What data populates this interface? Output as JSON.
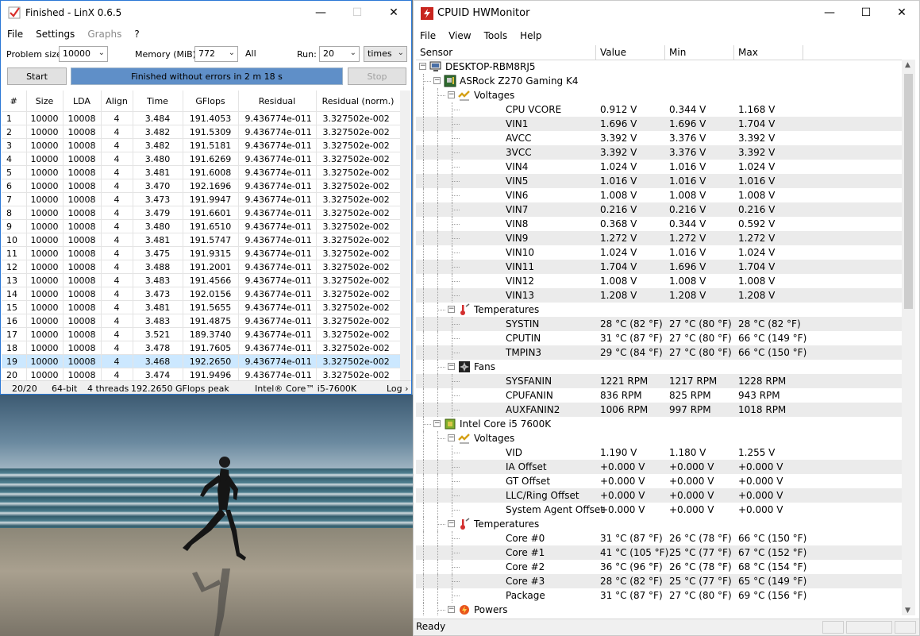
{
  "linx": {
    "title": "Finished - LinX 0.6.5",
    "menu": [
      "File",
      "Settings",
      "Graphs",
      "?"
    ],
    "problem_size_label": "Problem size:",
    "problem_size_value": "10000",
    "memory_label": "Memory (MiB):",
    "memory_value": "772",
    "memory_all": "All",
    "run_label": "Run:",
    "run_value": "20",
    "run_unit": "times",
    "start_label": "Start",
    "stop_label": "Stop",
    "progress_text": "Finished without errors in 2 m 18 s",
    "progress_fraction": 1.0,
    "columns": [
      "#",
      "Size",
      "LDA",
      "Align",
      "Time",
      "GFlops",
      "Residual",
      "Residual (norm.)"
    ],
    "rows": [
      [
        "1",
        "10000",
        "10008",
        "4",
        "3.484",
        "191.4053",
        "9.436774e-011",
        "3.327502e-002"
      ],
      [
        "2",
        "10000",
        "10008",
        "4",
        "3.482",
        "191.5309",
        "9.436774e-011",
        "3.327502e-002"
      ],
      [
        "3",
        "10000",
        "10008",
        "4",
        "3.482",
        "191.5181",
        "9.436774e-011",
        "3.327502e-002"
      ],
      [
        "4",
        "10000",
        "10008",
        "4",
        "3.480",
        "191.6269",
        "9.436774e-011",
        "3.327502e-002"
      ],
      [
        "5",
        "10000",
        "10008",
        "4",
        "3.481",
        "191.6008",
        "9.436774e-011",
        "3.327502e-002"
      ],
      [
        "6",
        "10000",
        "10008",
        "4",
        "3.470",
        "192.1696",
        "9.436774e-011",
        "3.327502e-002"
      ],
      [
        "7",
        "10000",
        "10008",
        "4",
        "3.473",
        "191.9947",
        "9.436774e-011",
        "3.327502e-002"
      ],
      [
        "8",
        "10000",
        "10008",
        "4",
        "3.479",
        "191.6601",
        "9.436774e-011",
        "3.327502e-002"
      ],
      [
        "9",
        "10000",
        "10008",
        "4",
        "3.480",
        "191.6510",
        "9.436774e-011",
        "3.327502e-002"
      ],
      [
        "10",
        "10000",
        "10008",
        "4",
        "3.481",
        "191.5747",
        "9.436774e-011",
        "3.327502e-002"
      ],
      [
        "11",
        "10000",
        "10008",
        "4",
        "3.475",
        "191.9315",
        "9.436774e-011",
        "3.327502e-002"
      ],
      [
        "12",
        "10000",
        "10008",
        "4",
        "3.488",
        "191.2001",
        "9.436774e-011",
        "3.327502e-002"
      ],
      [
        "13",
        "10000",
        "10008",
        "4",
        "3.483",
        "191.4566",
        "9.436774e-011",
        "3.327502e-002"
      ],
      [
        "14",
        "10000",
        "10008",
        "4",
        "3.473",
        "192.0156",
        "9.436774e-011",
        "3.327502e-002"
      ],
      [
        "15",
        "10000",
        "10008",
        "4",
        "3.481",
        "191.5655",
        "9.436774e-011",
        "3.327502e-002"
      ],
      [
        "16",
        "10000",
        "10008",
        "4",
        "3.483",
        "191.4875",
        "9.436774e-011",
        "3.327502e-002"
      ],
      [
        "17",
        "10000",
        "10008",
        "4",
        "3.521",
        "189.3740",
        "9.436774e-011",
        "3.327502e-002"
      ],
      [
        "18",
        "10000",
        "10008",
        "4",
        "3.478",
        "191.7605",
        "9.436774e-011",
        "3.327502e-002"
      ],
      [
        "19",
        "10000",
        "10008",
        "4",
        "3.468",
        "192.2650",
        "9.436774e-011",
        "3.327502e-002"
      ],
      [
        "20",
        "10000",
        "10008",
        "4",
        "3.474",
        "191.9496",
        "9.436774e-011",
        "3.327502e-002"
      ]
    ],
    "selected_row": "19",
    "status": {
      "runs": "20/20",
      "bits": "64-bit",
      "threads": "4 threads",
      "peak": "192.2650 GFlops peak",
      "cpu": "Intel® Core™ i5-7600K",
      "log": "Log ›"
    }
  },
  "hwm": {
    "title": "CPUID HWMonitor",
    "menu": [
      "File",
      "View",
      "Tools",
      "Help"
    ],
    "columns": [
      "Sensor",
      "Value",
      "Min",
      "Max"
    ],
    "status_text": "Ready",
    "rows": [
      {
        "type": "root",
        "name": "DESKTOP-RBM8RJ5",
        "icon": "computer-icon"
      },
      {
        "type": "device",
        "name": "ASRock Z270 Gaming K4",
        "icon": "motherboard-icon"
      },
      {
        "type": "group",
        "name": "Voltages",
        "icon": "voltage-icon"
      },
      {
        "type": "sensor",
        "name": "CPU VCORE",
        "value": "0.912 V",
        "min": "0.344 V",
        "max": "1.168 V"
      },
      {
        "type": "sensor",
        "name": "VIN1",
        "value": "1.696 V",
        "min": "1.696 V",
        "max": "1.704 V"
      },
      {
        "type": "sensor",
        "name": "AVCC",
        "value": "3.392 V",
        "min": "3.376 V",
        "max": "3.392 V"
      },
      {
        "type": "sensor",
        "name": "3VCC",
        "value": "3.392 V",
        "min": "3.376 V",
        "max": "3.392 V"
      },
      {
        "type": "sensor",
        "name": "VIN4",
        "value": "1.024 V",
        "min": "1.016 V",
        "max": "1.024 V"
      },
      {
        "type": "sensor",
        "name": "VIN5",
        "value": "1.016 V",
        "min": "1.016 V",
        "max": "1.016 V"
      },
      {
        "type": "sensor",
        "name": "VIN6",
        "value": "1.008 V",
        "min": "1.008 V",
        "max": "1.008 V"
      },
      {
        "type": "sensor",
        "name": "VIN7",
        "value": "0.216 V",
        "min": "0.216 V",
        "max": "0.216 V"
      },
      {
        "type": "sensor",
        "name": "VIN8",
        "value": "0.368 V",
        "min": "0.344 V",
        "max": "0.592 V"
      },
      {
        "type": "sensor",
        "name": "VIN9",
        "value": "1.272 V",
        "min": "1.272 V",
        "max": "1.272 V"
      },
      {
        "type": "sensor",
        "name": "VIN10",
        "value": "1.024 V",
        "min": "1.016 V",
        "max": "1.024 V"
      },
      {
        "type": "sensor",
        "name": "VIN11",
        "value": "1.704 V",
        "min": "1.696 V",
        "max": "1.704 V"
      },
      {
        "type": "sensor",
        "name": "VIN12",
        "value": "1.008 V",
        "min": "1.008 V",
        "max": "1.008 V"
      },
      {
        "type": "sensor",
        "name": "VIN13",
        "value": "1.208 V",
        "min": "1.208 V",
        "max": "1.208 V"
      },
      {
        "type": "group",
        "name": "Temperatures",
        "icon": "thermometer-icon"
      },
      {
        "type": "sensor",
        "name": "SYSTIN",
        "value": "28 °C  (82 °F)",
        "min": "27 °C  (80 °F)",
        "max": "28 °C  (82 °F)"
      },
      {
        "type": "sensor",
        "name": "CPUTIN",
        "value": "31 °C  (87 °F)",
        "min": "27 °C  (80 °F)",
        "max": "66 °C  (149 °F)"
      },
      {
        "type": "sensor",
        "name": "TMPIN3",
        "value": "29 °C  (84 °F)",
        "min": "27 °C  (80 °F)",
        "max": "66 °C  (150 °F)"
      },
      {
        "type": "group",
        "name": "Fans",
        "icon": "fan-icon"
      },
      {
        "type": "sensor",
        "name": "SYSFANIN",
        "value": "1221 RPM",
        "min": "1217 RPM",
        "max": "1228 RPM"
      },
      {
        "type": "sensor",
        "name": "CPUFANIN",
        "value": "836 RPM",
        "min": "825 RPM",
        "max": "943 RPM"
      },
      {
        "type": "sensor",
        "name": "AUXFANIN2",
        "value": "1006 RPM",
        "min": "997 RPM",
        "max": "1018 RPM"
      },
      {
        "type": "device",
        "name": "Intel Core i5 7600K",
        "icon": "cpu-icon"
      },
      {
        "type": "group",
        "name": "Voltages",
        "icon": "voltage-icon"
      },
      {
        "type": "sensor",
        "name": "VID",
        "value": "1.190 V",
        "min": "1.180 V",
        "max": "1.255 V"
      },
      {
        "type": "sensor",
        "name": "IA Offset",
        "value": "+0.000 V",
        "min": "+0.000 V",
        "max": "+0.000 V"
      },
      {
        "type": "sensor",
        "name": "GT Offset",
        "value": "+0.000 V",
        "min": "+0.000 V",
        "max": "+0.000 V"
      },
      {
        "type": "sensor",
        "name": "LLC/Ring Offset",
        "value": "+0.000 V",
        "min": "+0.000 V",
        "max": "+0.000 V"
      },
      {
        "type": "sensor",
        "name": "System Agent Offset",
        "value": "+0.000 V",
        "min": "+0.000 V",
        "max": "+0.000 V"
      },
      {
        "type": "group",
        "name": "Temperatures",
        "icon": "thermometer-icon"
      },
      {
        "type": "sensor",
        "name": "Core #0",
        "value": "31 °C  (87 °F)",
        "min": "26 °C  (78 °F)",
        "max": "66 °C  (150 °F)"
      },
      {
        "type": "sensor",
        "name": "Core #1",
        "value": "41 °C  (105 °F)",
        "min": "25 °C  (77 °F)",
        "max": "67 °C  (152 °F)"
      },
      {
        "type": "sensor",
        "name": "Core #2",
        "value": "36 °C  (96 °F)",
        "min": "26 °C  (78 °F)",
        "max": "68 °C  (154 °F)"
      },
      {
        "type": "sensor",
        "name": "Core #3",
        "value": "28 °C  (82 °F)",
        "min": "25 °C  (77 °F)",
        "max": "65 °C  (149 °F)"
      },
      {
        "type": "sensor",
        "name": "Package",
        "value": "31 °C  (87 °F)",
        "min": "27 °C  (80 °F)",
        "max": "69 °C  (156 °F)"
      },
      {
        "type": "group",
        "name": "Powers",
        "icon": "power-icon"
      }
    ]
  },
  "colors": {
    "accent_border": "#2b78d6",
    "progress_fill": "#5f8fc8",
    "selection": "#cce8ff",
    "hwm_alt_row": "#ebebeb"
  }
}
